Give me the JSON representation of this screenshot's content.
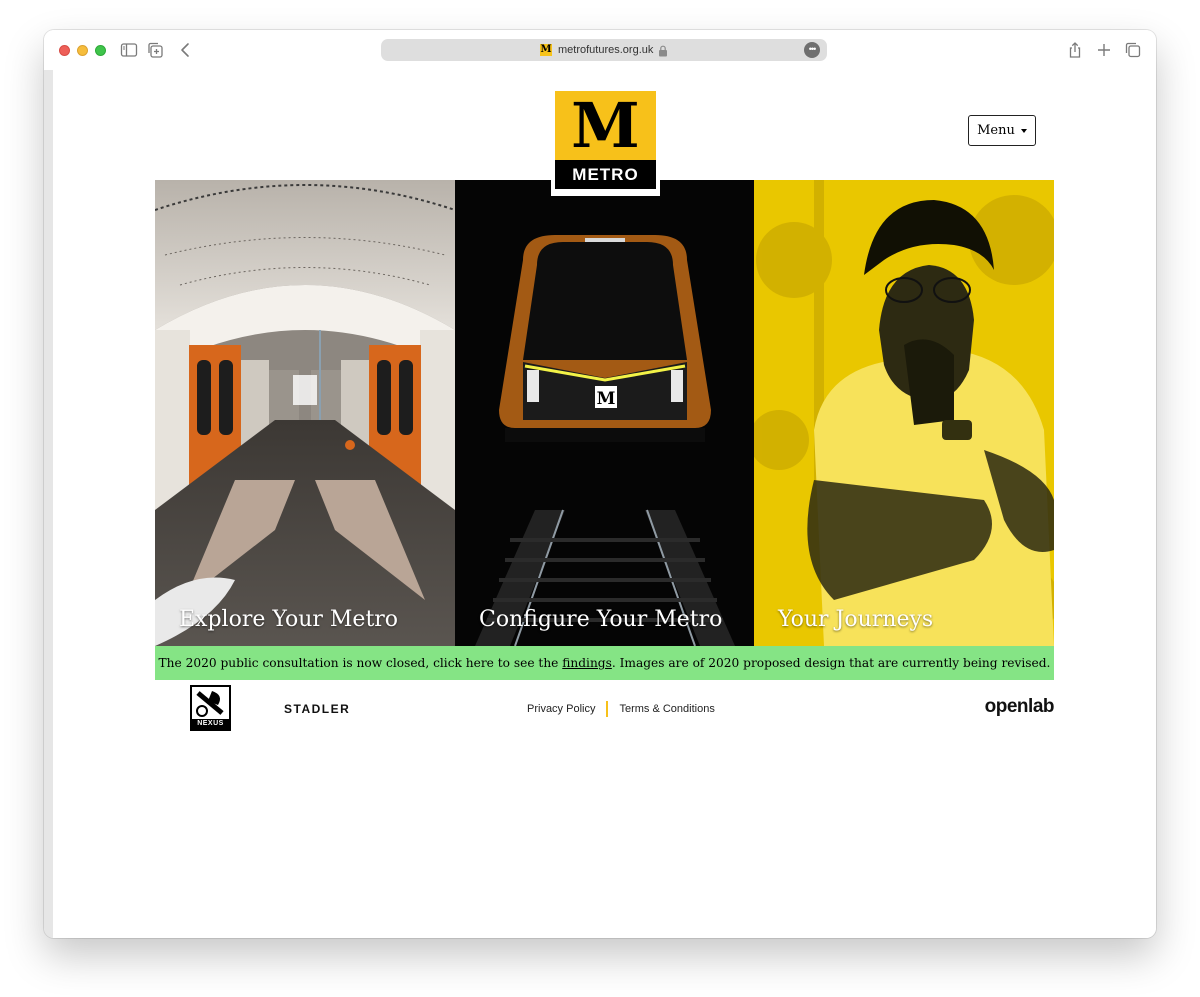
{
  "browser": {
    "url": "metrofutures.org.uk"
  },
  "header": {
    "logo_text": "METRO",
    "logo_letter": "M",
    "menu_label": "Menu"
  },
  "panels": [
    {
      "title": "Explore Your Metro"
    },
    {
      "title": "Configure Your Metro"
    },
    {
      "title": "Your Journeys"
    }
  ],
  "banner": {
    "text_before": "The 2020 public consultation is now closed, click here to see the ",
    "link_text": "findings",
    "text_after": ". Images are of 2020 proposed design that are currently being revised."
  },
  "footer": {
    "nexus_label": "NEXUS",
    "stadler_label": "STADLER",
    "privacy_label": "Privacy Policy",
    "terms_label": "Terms & Conditions",
    "openlab_label": "openlab"
  },
  "colors": {
    "brand_yellow": "#f7c11a",
    "banner_green": "#85e485"
  }
}
